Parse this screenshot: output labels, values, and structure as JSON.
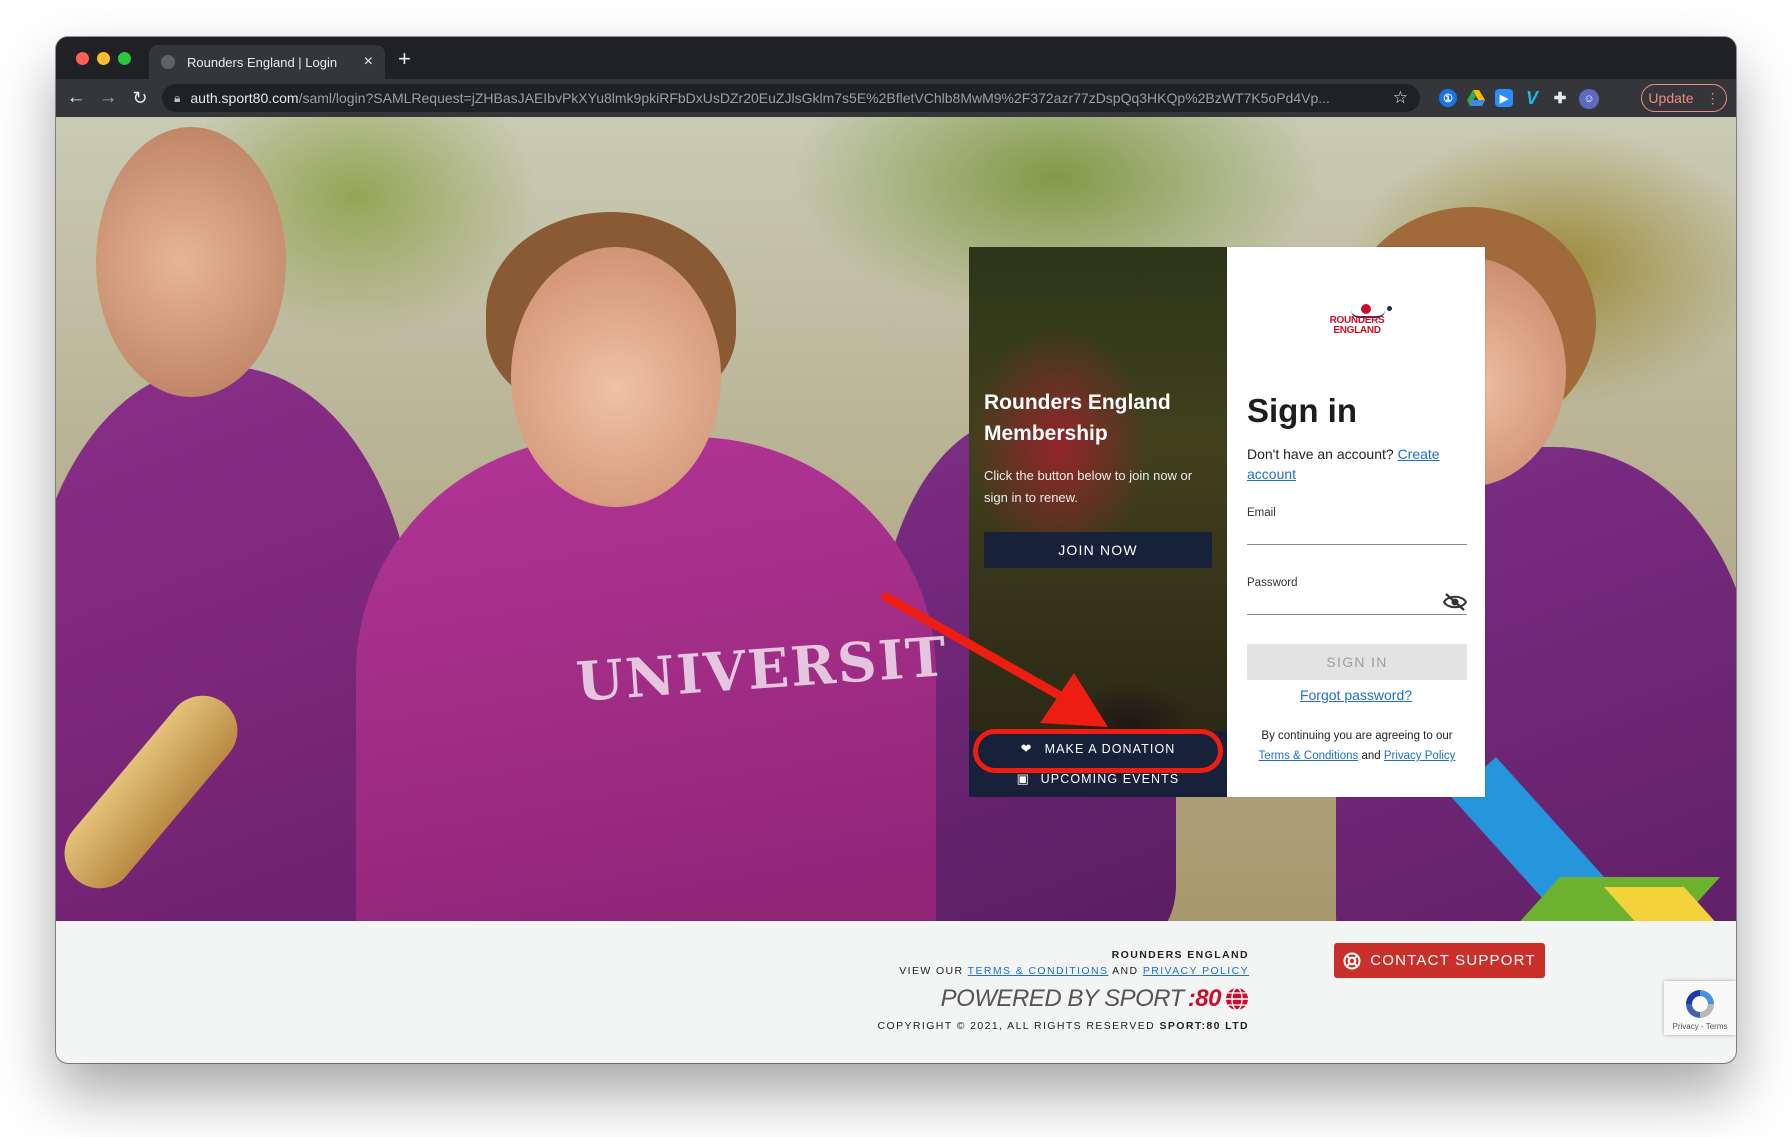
{
  "browser": {
    "tab_title": "Rounders England | Login",
    "url_host": "auth.sport80.com",
    "url_rest": "/saml/login?SAMLRequest=jZHBasJAEIbvPkXYu8lmk9pkiRFbDxUsDZr20EuZJlsGklm7s5E%2BfletVChlb8MwM9%2F372azr77zDspQq3HKQp%2BzWT7K5oPd4Vp...",
    "update_label": "Update"
  },
  "membership": {
    "title": "Rounders England Membership",
    "description": "Click the button below to join now or sign in to renew.",
    "join_label": "JOIN NOW",
    "donate_label": "MAKE A DONATION",
    "events_label": "UPCOMING EVENTS"
  },
  "hero": {
    "shirt_text": "UNIVERSIT"
  },
  "signin": {
    "logo_line1": "ROUNDERS",
    "logo_line2": "ENGLAND",
    "title": "Sign in",
    "no_account": "Don't have an account?",
    "create_account": "Create account",
    "email_label": "Email",
    "email_value": "",
    "password_label": "Password",
    "password_value": "",
    "button_label": "SIGN IN",
    "forgot_label": "Forgot password?",
    "terms_prefix": "By continuing you are agreeing to our",
    "terms_link": "Terms & Conditions",
    "terms_and": "and",
    "privacy_link": "Privacy Policy"
  },
  "footer": {
    "org": "ROUNDERS ENGLAND",
    "view_our": "VIEW OUR",
    "terms_link": "TERMS & CONDITIONS",
    "and": "AND",
    "privacy_link": "PRIVACY POLICY",
    "powered_by": "POWERED BY SPORT",
    "powered_accent": ":80",
    "copyright": "COPYRIGHT © 2021, ALL RIGHTS RESERVED",
    "copyright_brand": "SPORT:80 LTD",
    "contact_label": "CONTACT SUPPORT",
    "recaptcha_text": "Privacy - Terms"
  },
  "colors": {
    "navy": "#17213a",
    "brand_red": "#c8102e",
    "annotation_red": "#ee1d12",
    "link_blue": "#1f6fc8",
    "support_red": "#c9302c"
  },
  "icons": {
    "donate": "hand-heart-icon",
    "events": "calendar-icon",
    "password_toggle": "eye-off-icon",
    "support": "lifebuoy-icon"
  }
}
